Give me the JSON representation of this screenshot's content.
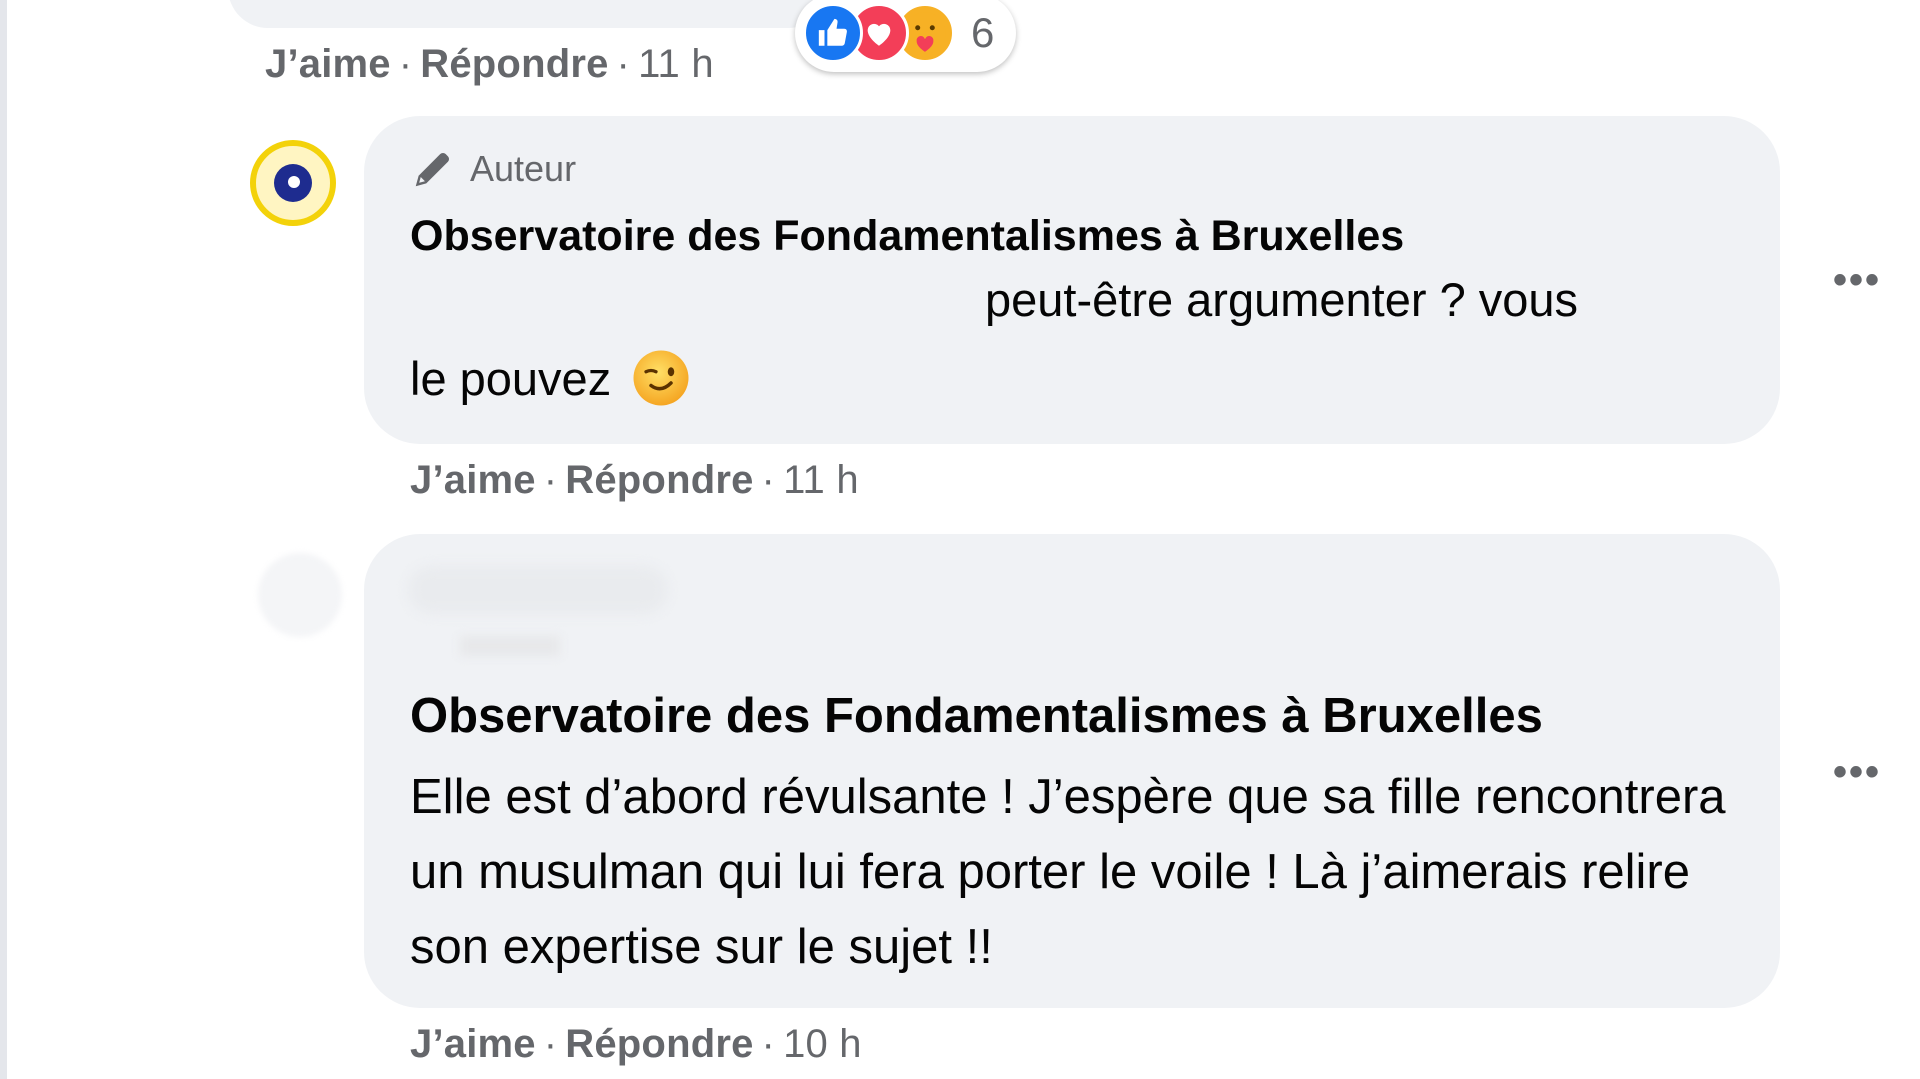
{
  "top_comment": {
    "actions": {
      "like": "J’aime",
      "reply": "Répondre",
      "time": "11 h"
    },
    "reactions": {
      "icons": [
        "like-icon",
        "love-icon",
        "care-icon"
      ],
      "count": "6",
      "colors": {
        "like": "#1877f2",
        "love": "#f33e58",
        "care": "#f7b125"
      }
    }
  },
  "reply1": {
    "badge": "Auteur",
    "badge_icon": "pencil-icon",
    "author": "Observatoire des Fondamentalismes à Bruxelles",
    "text_line1": "peut-être argumenter ? vous",
    "text_line2": "le pouvez",
    "emoji": "wink-emoji",
    "more": "•••",
    "actions": {
      "like": "J’aime",
      "reply": "Répondre",
      "time": "11 h"
    }
  },
  "reply2": {
    "author": "Observatoire des Fondamentalismes à Bruxelles",
    "text": "Elle est d’abord révulsante ! J’espère que sa fille rencontrera un musulman qui lui fera porter le voile ! Là j’aimerais relire son expertise sur le sujet !!",
    "more": "•••",
    "actions": {
      "like": "J’aime",
      "reply": "Répondre",
      "time": "10 h"
    }
  },
  "colors": {
    "bubble_bg": "#f0f2f5",
    "secondary_text": "#65676b",
    "primary_text": "#050505"
  }
}
